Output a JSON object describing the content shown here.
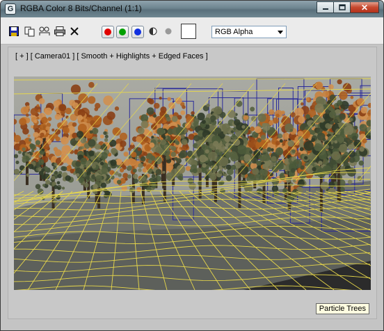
{
  "window": {
    "title": "RGBA Color 8 Bits/Channel (1:1)",
    "icon": "3dsmax-app-icon"
  },
  "title_buttons": {
    "minimize": "minimize-icon",
    "maximize": "maximize-icon",
    "close": "close-icon"
  },
  "toolbar": {
    "icons": [
      "save-icon",
      "copy-icon",
      "clone-icon",
      "print-icon",
      "clear-icon"
    ],
    "channels": [
      {
        "name": "red",
        "color": "#e00000"
      },
      {
        "name": "green",
        "color": "#00a000"
      },
      {
        "name": "blue",
        "color": "#1030e0"
      }
    ],
    "channel_icons": [
      "monochrome-icon",
      "alpha-dot-icon"
    ],
    "swatch_color": "#ffffff",
    "display_channel": "RGB Alpha"
  },
  "viewport": {
    "label": "[ + ] [ Camera01 ] [ Smooth + Highlights + Edged Faces ]",
    "badge": "Particle Trees"
  },
  "colors": {
    "wireframe": "#e8d84a",
    "bbox": "#2a2a9a",
    "autumn": "#b0621f"
  }
}
